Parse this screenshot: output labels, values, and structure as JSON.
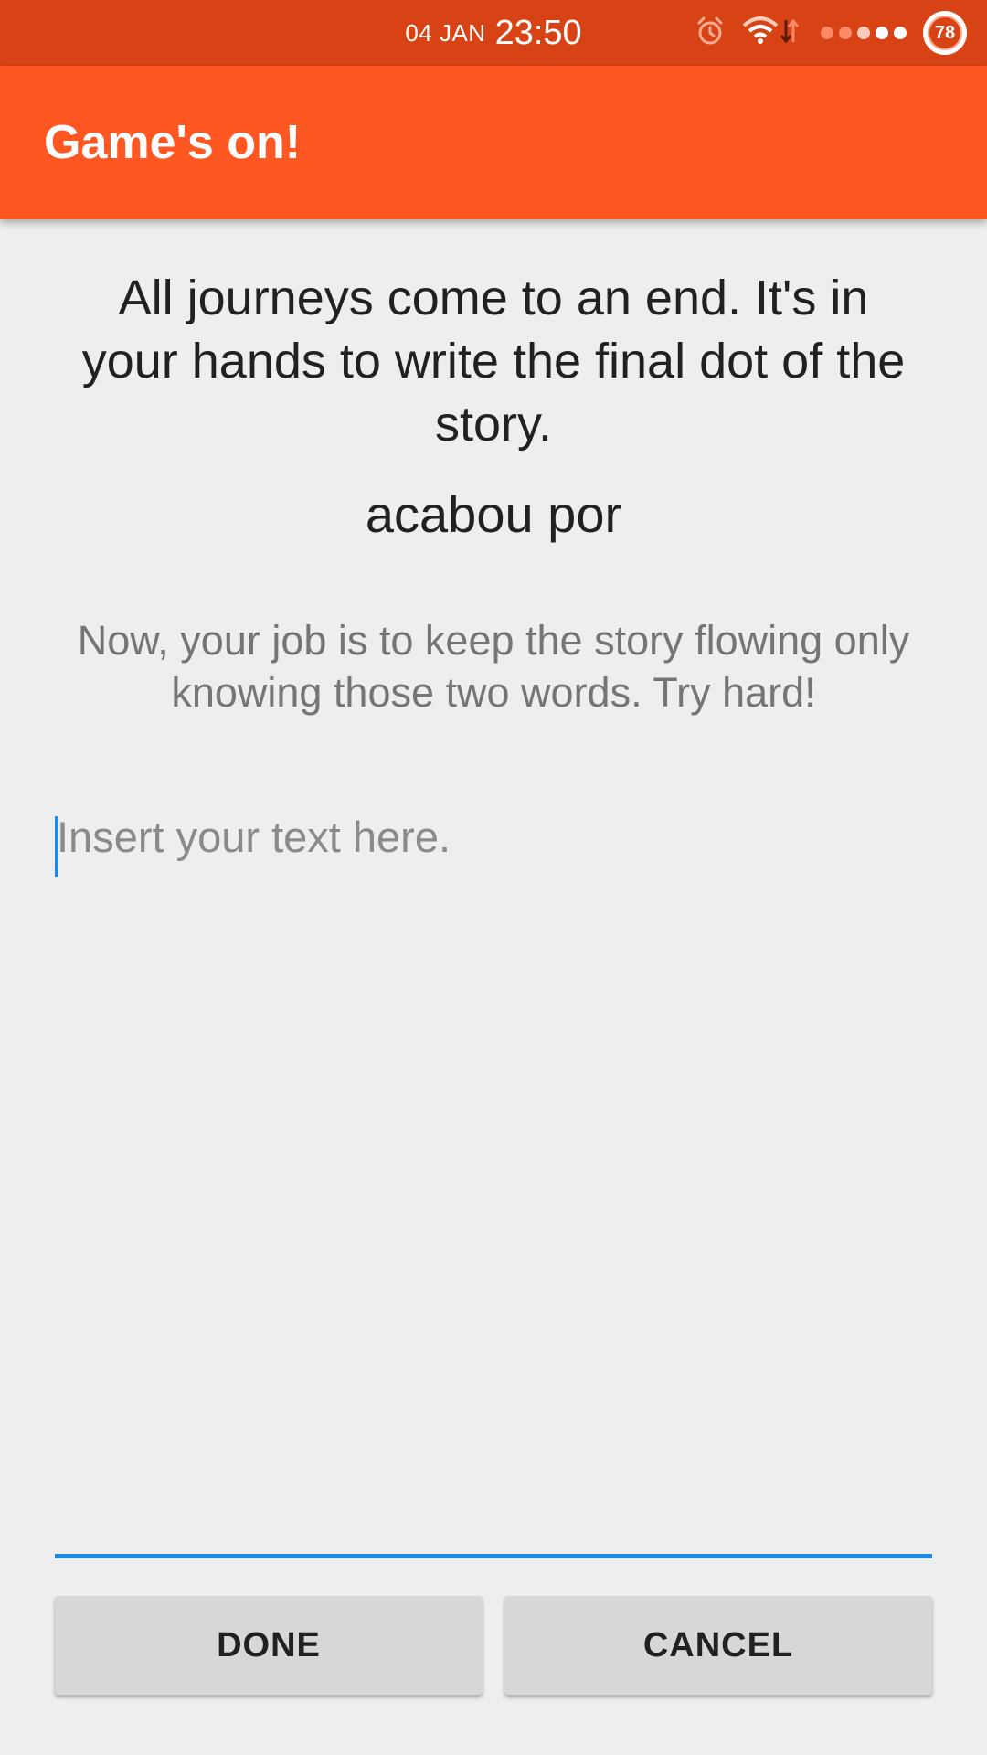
{
  "status_bar": {
    "date": "04 JAN",
    "time": "23:50",
    "battery": "78",
    "icons": [
      "alarm-icon",
      "wifi-icon",
      "data-arrows-icon",
      "signal-dots-icon",
      "battery-icon"
    ]
  },
  "app_bar": {
    "title": "Game's on!"
  },
  "content": {
    "prompt": "All journeys come to an end. It's in your hands to write the final dot of the story.",
    "words": "acabou por",
    "instructions": "Now, your job is to keep the story flowing only knowing those two words. Try hard!"
  },
  "input": {
    "placeholder": "Insert your text here.",
    "value": ""
  },
  "buttons": {
    "done": "DONE",
    "cancel": "CANCEL"
  },
  "colors": {
    "status_bar": "#d84315",
    "app_bar": "#ff5722",
    "accent": "#1e88e5",
    "background": "#eeeeee",
    "button": "#d6d7d7"
  }
}
